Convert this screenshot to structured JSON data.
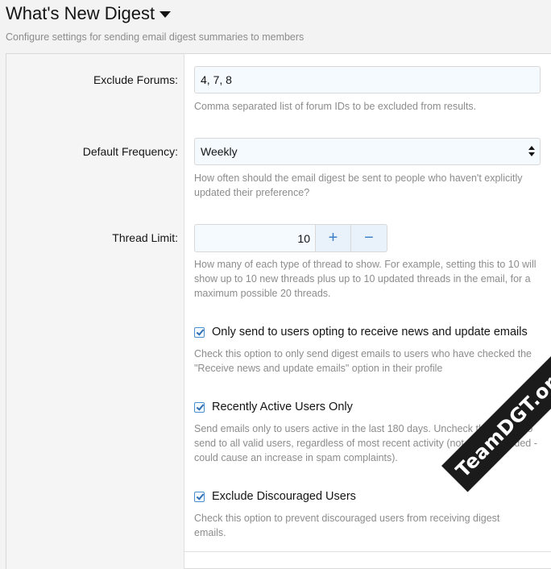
{
  "header": {
    "title": "What's New Digest",
    "subtitle": "Configure settings for sending email digest summaries to members"
  },
  "fields": {
    "exclude_forums": {
      "label": "Exclude Forums:",
      "value": "4, 7, 8",
      "hint": "Comma separated list of forum IDs to be excluded from results."
    },
    "default_frequency": {
      "label": "Default Frequency:",
      "value": "Weekly",
      "hint": "How often should the email digest be sent to people who haven't explicitly updated their preference?"
    },
    "thread_limit": {
      "label": "Thread Limit:",
      "value": "10",
      "plus": "+",
      "minus": "−",
      "hint": "How many of each type of thread to show. For example, setting this to 10 will show up to 10 new threads plus up to 10 updated threads in the email, for a maximum possible 20 threads."
    },
    "opting_only": {
      "label": "Only send to users opting to receive news and update emails",
      "checked": true,
      "hint": "Check this option to only send digest emails to users who have checked the \"Receive news and update emails\" option in their profile"
    },
    "recently_active": {
      "label": "Recently Active Users Only",
      "checked": true,
      "hint": "Send emails only to users active in the last 180 days. Uncheck this option to send to all valid users, regardless of most recent activity (not recommended - could cause an increase in spam complaints)."
    },
    "exclude_discouraged": {
      "label": "Exclude Discouraged Users",
      "checked": true,
      "hint": "Check this option to prevent discouraged users from receiving digest emails."
    }
  },
  "watermark": "TeamDGT.org",
  "colors": {
    "accent": "#3a7fc6",
    "input_bg": "#f5fafe",
    "hint_text": "#8c8c8c",
    "page_bg": "#f3f3f3"
  }
}
